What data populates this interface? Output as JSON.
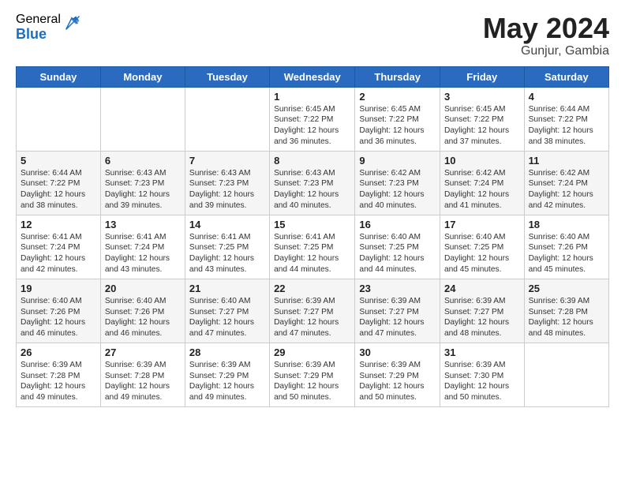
{
  "logo": {
    "general": "General",
    "blue": "Blue"
  },
  "title": "May 2024",
  "subtitle": "Gunjur, Gambia",
  "days_of_week": [
    "Sunday",
    "Monday",
    "Tuesday",
    "Wednesday",
    "Thursday",
    "Friday",
    "Saturday"
  ],
  "weeks": [
    [
      {
        "day": "",
        "sunrise": "",
        "sunset": "",
        "daylight": ""
      },
      {
        "day": "",
        "sunrise": "",
        "sunset": "",
        "daylight": ""
      },
      {
        "day": "",
        "sunrise": "",
        "sunset": "",
        "daylight": ""
      },
      {
        "day": "1",
        "sunrise": "Sunrise: 6:45 AM",
        "sunset": "Sunset: 7:22 PM",
        "daylight": "Daylight: 12 hours and 36 minutes."
      },
      {
        "day": "2",
        "sunrise": "Sunrise: 6:45 AM",
        "sunset": "Sunset: 7:22 PM",
        "daylight": "Daylight: 12 hours and 36 minutes."
      },
      {
        "day": "3",
        "sunrise": "Sunrise: 6:45 AM",
        "sunset": "Sunset: 7:22 PM",
        "daylight": "Daylight: 12 hours and 37 minutes."
      },
      {
        "day": "4",
        "sunrise": "Sunrise: 6:44 AM",
        "sunset": "Sunset: 7:22 PM",
        "daylight": "Daylight: 12 hours and 38 minutes."
      }
    ],
    [
      {
        "day": "5",
        "sunrise": "Sunrise: 6:44 AM",
        "sunset": "Sunset: 7:22 PM",
        "daylight": "Daylight: 12 hours and 38 minutes."
      },
      {
        "day": "6",
        "sunrise": "Sunrise: 6:43 AM",
        "sunset": "Sunset: 7:23 PM",
        "daylight": "Daylight: 12 hours and 39 minutes."
      },
      {
        "day": "7",
        "sunrise": "Sunrise: 6:43 AM",
        "sunset": "Sunset: 7:23 PM",
        "daylight": "Daylight: 12 hours and 39 minutes."
      },
      {
        "day": "8",
        "sunrise": "Sunrise: 6:43 AM",
        "sunset": "Sunset: 7:23 PM",
        "daylight": "Daylight: 12 hours and 40 minutes."
      },
      {
        "day": "9",
        "sunrise": "Sunrise: 6:42 AM",
        "sunset": "Sunset: 7:23 PM",
        "daylight": "Daylight: 12 hours and 40 minutes."
      },
      {
        "day": "10",
        "sunrise": "Sunrise: 6:42 AM",
        "sunset": "Sunset: 7:24 PM",
        "daylight": "Daylight: 12 hours and 41 minutes."
      },
      {
        "day": "11",
        "sunrise": "Sunrise: 6:42 AM",
        "sunset": "Sunset: 7:24 PM",
        "daylight": "Daylight: 12 hours and 42 minutes."
      }
    ],
    [
      {
        "day": "12",
        "sunrise": "Sunrise: 6:41 AM",
        "sunset": "Sunset: 7:24 PM",
        "daylight": "Daylight: 12 hours and 42 minutes."
      },
      {
        "day": "13",
        "sunrise": "Sunrise: 6:41 AM",
        "sunset": "Sunset: 7:24 PM",
        "daylight": "Daylight: 12 hours and 43 minutes."
      },
      {
        "day": "14",
        "sunrise": "Sunrise: 6:41 AM",
        "sunset": "Sunset: 7:25 PM",
        "daylight": "Daylight: 12 hours and 43 minutes."
      },
      {
        "day": "15",
        "sunrise": "Sunrise: 6:41 AM",
        "sunset": "Sunset: 7:25 PM",
        "daylight": "Daylight: 12 hours and 44 minutes."
      },
      {
        "day": "16",
        "sunrise": "Sunrise: 6:40 AM",
        "sunset": "Sunset: 7:25 PM",
        "daylight": "Daylight: 12 hours and 44 minutes."
      },
      {
        "day": "17",
        "sunrise": "Sunrise: 6:40 AM",
        "sunset": "Sunset: 7:25 PM",
        "daylight": "Daylight: 12 hours and 45 minutes."
      },
      {
        "day": "18",
        "sunrise": "Sunrise: 6:40 AM",
        "sunset": "Sunset: 7:26 PM",
        "daylight": "Daylight: 12 hours and 45 minutes."
      }
    ],
    [
      {
        "day": "19",
        "sunrise": "Sunrise: 6:40 AM",
        "sunset": "Sunset: 7:26 PM",
        "daylight": "Daylight: 12 hours and 46 minutes."
      },
      {
        "day": "20",
        "sunrise": "Sunrise: 6:40 AM",
        "sunset": "Sunset: 7:26 PM",
        "daylight": "Daylight: 12 hours and 46 minutes."
      },
      {
        "day": "21",
        "sunrise": "Sunrise: 6:40 AM",
        "sunset": "Sunset: 7:27 PM",
        "daylight": "Daylight: 12 hours and 47 minutes."
      },
      {
        "day": "22",
        "sunrise": "Sunrise: 6:39 AM",
        "sunset": "Sunset: 7:27 PM",
        "daylight": "Daylight: 12 hours and 47 minutes."
      },
      {
        "day": "23",
        "sunrise": "Sunrise: 6:39 AM",
        "sunset": "Sunset: 7:27 PM",
        "daylight": "Daylight: 12 hours and 47 minutes."
      },
      {
        "day": "24",
        "sunrise": "Sunrise: 6:39 AM",
        "sunset": "Sunset: 7:27 PM",
        "daylight": "Daylight: 12 hours and 48 minutes."
      },
      {
        "day": "25",
        "sunrise": "Sunrise: 6:39 AM",
        "sunset": "Sunset: 7:28 PM",
        "daylight": "Daylight: 12 hours and 48 minutes."
      }
    ],
    [
      {
        "day": "26",
        "sunrise": "Sunrise: 6:39 AM",
        "sunset": "Sunset: 7:28 PM",
        "daylight": "Daylight: 12 hours and 49 minutes."
      },
      {
        "day": "27",
        "sunrise": "Sunrise: 6:39 AM",
        "sunset": "Sunset: 7:28 PM",
        "daylight": "Daylight: 12 hours and 49 minutes."
      },
      {
        "day": "28",
        "sunrise": "Sunrise: 6:39 AM",
        "sunset": "Sunset: 7:29 PM",
        "daylight": "Daylight: 12 hours and 49 minutes."
      },
      {
        "day": "29",
        "sunrise": "Sunrise: 6:39 AM",
        "sunset": "Sunset: 7:29 PM",
        "daylight": "Daylight: 12 hours and 50 minutes."
      },
      {
        "day": "30",
        "sunrise": "Sunrise: 6:39 AM",
        "sunset": "Sunset: 7:29 PM",
        "daylight": "Daylight: 12 hours and 50 minutes."
      },
      {
        "day": "31",
        "sunrise": "Sunrise: 6:39 AM",
        "sunset": "Sunset: 7:30 PM",
        "daylight": "Daylight: 12 hours and 50 minutes."
      },
      {
        "day": "",
        "sunrise": "",
        "sunset": "",
        "daylight": ""
      }
    ]
  ],
  "colors": {
    "header_bg": "#2a6bbf",
    "header_text": "#ffffff",
    "accent": "#1a6fc4"
  }
}
